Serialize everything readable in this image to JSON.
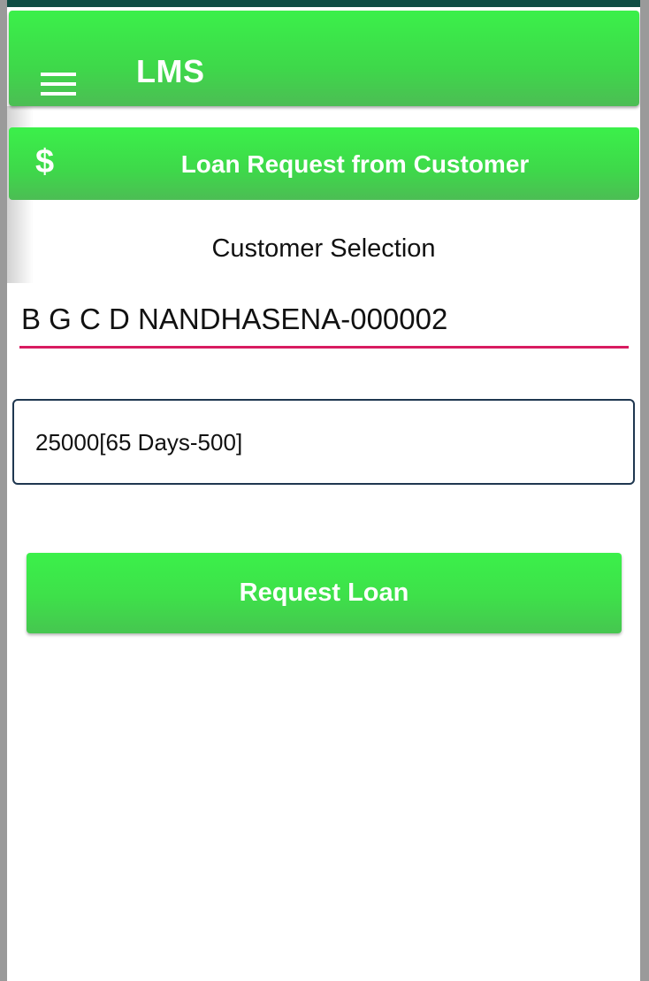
{
  "app": {
    "title": "LMS",
    "menu_icon": "hamburger-menu-icon"
  },
  "section": {
    "icon": "dollar-icon",
    "icon_glyph": "$",
    "title": "Loan Request from Customer"
  },
  "form": {
    "customer_label": "Customer Selection",
    "customer_value": "B G C D NANDHASENA-000002",
    "loan_value": "25000[65 Days-500]",
    "submit_label": "Request Loan"
  },
  "colors": {
    "primary_green": "#3ED84A",
    "underline_accent": "#D81B60",
    "select_border": "#1F3750"
  }
}
